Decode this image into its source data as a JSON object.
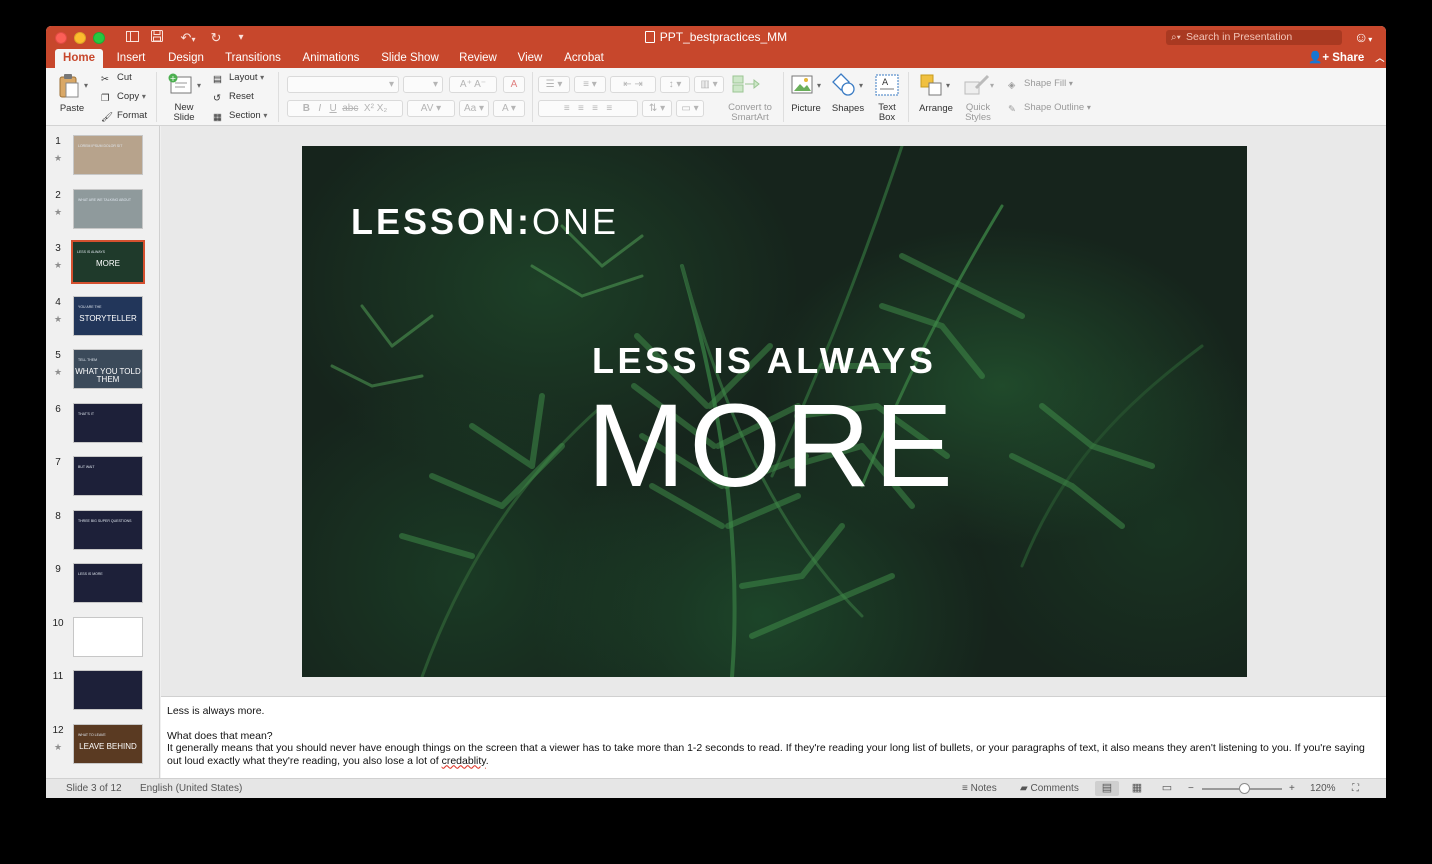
{
  "window": {
    "title": "PPT_bestpractices_MM"
  },
  "search": {
    "placeholder": "Search in Presentation"
  },
  "tabs": [
    "Home",
    "Insert",
    "Design",
    "Transitions",
    "Animations",
    "Slide Show",
    "Review",
    "View",
    "Acrobat"
  ],
  "share_label": "Share",
  "ribbon": {
    "paste": "Paste",
    "cut": "Cut",
    "copy": "Copy",
    "format": "Format",
    "new_slide_1": "New",
    "new_slide_2": "Slide",
    "layout": "Layout",
    "reset": "Reset",
    "section": "Section",
    "convert_1": "Convert to",
    "convert_2": "SmartArt",
    "picture": "Picture",
    "shapes": "Shapes",
    "text_box_1": "Text",
    "text_box_2": "Box",
    "arrange": "Arrange",
    "quick_styles_1": "Quick",
    "quick_styles_2": "Styles",
    "shape_fill": "Shape Fill",
    "shape_outline": "Shape Outline"
  },
  "thumbnails": [
    {
      "num": "1",
      "star": "★",
      "title": "",
      "sub": "LOREM IPSUM DOLOR SIT",
      "bg": "#b7a38c"
    },
    {
      "num": "2",
      "star": "★",
      "title": "",
      "sub": "WHAT ARE WE TALKING ABOUT",
      "bg": "#8f9a9c"
    },
    {
      "num": "3",
      "star": "★",
      "title": "MORE",
      "sub": "LESS IS ALWAYS",
      "bg": "#1f3a2b"
    },
    {
      "num": "4",
      "star": "★",
      "title": "STORYTELLER",
      "sub": "YOU ARE THE",
      "bg": "#22365a"
    },
    {
      "num": "5",
      "star": "★",
      "title": "WHAT YOU TOLD THEM",
      "sub": "TELL THEM",
      "bg": "#3b4a5a"
    },
    {
      "num": "6",
      "star": "",
      "title": "",
      "sub": "THAT'S IT",
      "bg": "#1d2039"
    },
    {
      "num": "7",
      "star": "",
      "title": "",
      "sub": "BUT WAIT",
      "bg": "#1d2039"
    },
    {
      "num": "8",
      "star": "",
      "title": "",
      "sub": "THREE BIG SUPER QUESTIONS",
      "bg": "#1d2039"
    },
    {
      "num": "9",
      "star": "",
      "title": "",
      "sub": "LESS IS MORE",
      "bg": "#1d2039"
    },
    {
      "num": "10",
      "star": "",
      "title": "",
      "sub": "",
      "bg": "#ffffff"
    },
    {
      "num": "11",
      "star": "",
      "title": "",
      "sub": "",
      "bg": "#1d2039"
    },
    {
      "num": "12",
      "star": "★",
      "title": "LEAVE BEHIND",
      "sub": "WHAT TO LEAVE",
      "bg": "#5a3a22"
    }
  ],
  "slide": {
    "lesson_bold": "LESSON:",
    "lesson_thin": "ONE",
    "line1": "LESS IS ALWAYS",
    "line2": "MORE"
  },
  "notes": {
    "p1": "Less is always more.",
    "p2": "What does that mean?",
    "p3a": "It generally means that you should never have enough things on the screen that a viewer has to take more than 1-2 seconds to read. If they're reading your long list of bullets, or your paragraphs of text, it also means they aren't listening to you. If you're saying out loud exactly what they're reading, you also lose a lot of ",
    "p3b": "credablity",
    "p3c": "."
  },
  "status": {
    "slide_of": "Slide 3 of 12",
    "language": "English (United States)",
    "notes": "Notes",
    "comments": "Comments",
    "zoom": "120%"
  }
}
